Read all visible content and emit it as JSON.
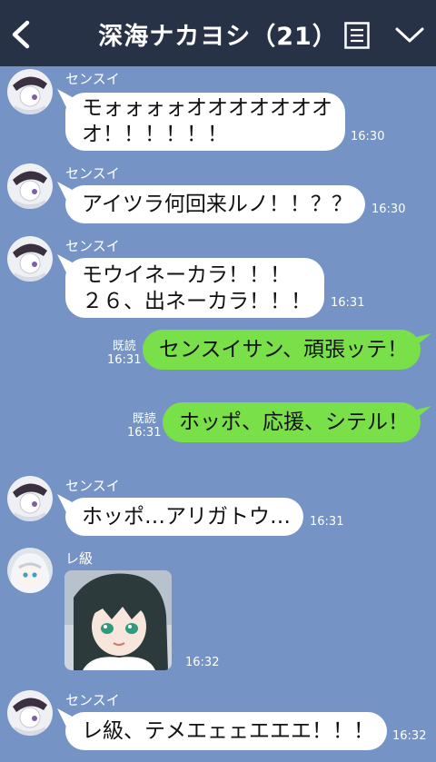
{
  "header": {
    "title": "深海ナカヨシ（21）"
  },
  "messages": [
    {
      "sender": "センスイ",
      "text": "モォォォォオオオオオオオ\nオ！！！！！！",
      "time": "16:30"
    },
    {
      "sender": "センスイ",
      "text": "アイツラ何回来ルノ！！？？",
      "time": "16:30"
    },
    {
      "sender": "センスイ",
      "text": "モウイネーカラ！！！\n２６、出ネーカラ！！！",
      "time": "16:31"
    },
    {
      "text": "センスイサン、頑張ッテ！",
      "read": "既読",
      "time": "16:31"
    },
    {
      "text": "ホッポ、応援、シテル！",
      "read": "既読",
      "time": "16:31"
    },
    {
      "sender": "センスイ",
      "text": "ホッポ…アリガトウ…",
      "time": "16:31"
    },
    {
      "sender": "レ級",
      "image": "anime-girl-sticker",
      "time": "16:32"
    },
    {
      "sender": "センスイ",
      "text": "レ級、テメエェェエエエ！！！",
      "time": "16:32"
    }
  ],
  "colors": {
    "header_bg": "#273246",
    "chat_bg": "#7593c4",
    "outgoing_bubble": "#79e04a",
    "incoming_bubble": "#ffffff"
  }
}
